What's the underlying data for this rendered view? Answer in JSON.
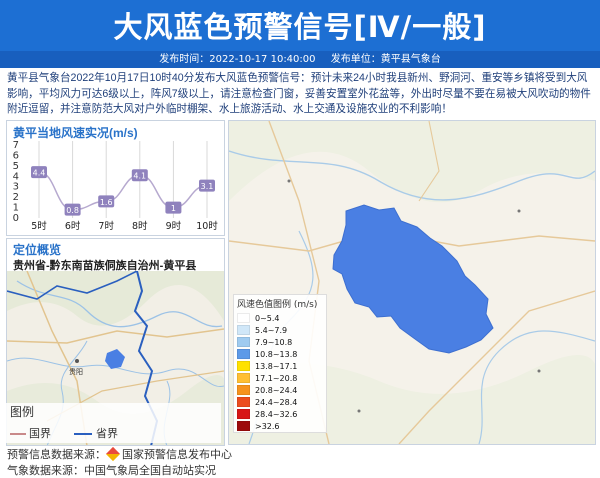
{
  "header": {
    "title": "大风蓝色预警信号[Ⅳ/一般]",
    "publish_time_label": "发布时间：2022-10-17 10:40:00",
    "publisher_label": "发布单位：黄平县气象台"
  },
  "description": "黄平县气象台2022年10月17日10时40分发布大风蓝色预警信号：预计未来24小时我县新州、野洞河、重安等乡镇将受到大风影响，平均风力可达6级以上，阵风7级以上，请注意检查门窗，妥善安置室外花盆等，外出时尽量不要在易被大风吹动的物件附近逗留，并注意防范大风对户外临时棚架、水上旅游活动、水上交通及设施农业的不利影响！",
  "wind_panel": {
    "title": "黄平当地风速实况(m/s)"
  },
  "chart_data": {
    "type": "line",
    "title": "黄平当地风速实况(m/s)",
    "categories": [
      "5时",
      "6时",
      "7时",
      "8时",
      "9时",
      "10时"
    ],
    "values": [
      4.4,
      0.8,
      1.6,
      4.1,
      1,
      3.1
    ],
    "value_labels": [
      "4.4",
      "0.8",
      "1.6",
      "4.1",
      "1",
      "3.1"
    ],
    "y_ticks": [
      "0",
      "1",
      "2",
      "3",
      "4",
      "5",
      "6",
      "7"
    ],
    "ylim": [
      0,
      7
    ],
    "line_color": "#b6a9cf",
    "label_bg": "#8f82bd",
    "grid": true
  },
  "location_panel": {
    "title": "定位概览",
    "subtitle": "贵州省-黔东南苗族侗族自治州-黄平县",
    "city_label": "贵阳",
    "legend_title": "图例",
    "legend_country": "国界",
    "legend_province": "省界"
  },
  "wind_legend": {
    "title": "风速色值图例 (m/s)",
    "items": [
      {
        "label": "0~5.4",
        "color": "#ffffff"
      },
      {
        "label": "5.4~7.9",
        "color": "#d0e7f8"
      },
      {
        "label": "7.9~10.8",
        "color": "#9fcbf0"
      },
      {
        "label": "10.8~13.8",
        "color": "#5d9ae8"
      },
      {
        "label": "13.8~17.1",
        "color": "#ffe100"
      },
      {
        "label": "17.1~20.8",
        "color": "#ffbf33"
      },
      {
        "label": "20.8~24.4",
        "color": "#f6931e"
      },
      {
        "label": "24.4~28.4",
        "color": "#ec4c1d"
      },
      {
        "label": "28.4~32.6",
        "color": "#d71616"
      },
      {
        "label": ">32.6",
        "color": "#9d0b0b"
      }
    ]
  },
  "footer": {
    "source_label": "预警信息数据来源：",
    "source_org": "国家预警信息发布中心",
    "source_line2": "气象数据来源：中国气象局全国自动站实况"
  },
  "colors": {
    "brand_blue": "#1d6fd3",
    "header_band": "#185fbe",
    "highlight_area": "#4a7fe3",
    "map_background": "#f5f2ea"
  }
}
